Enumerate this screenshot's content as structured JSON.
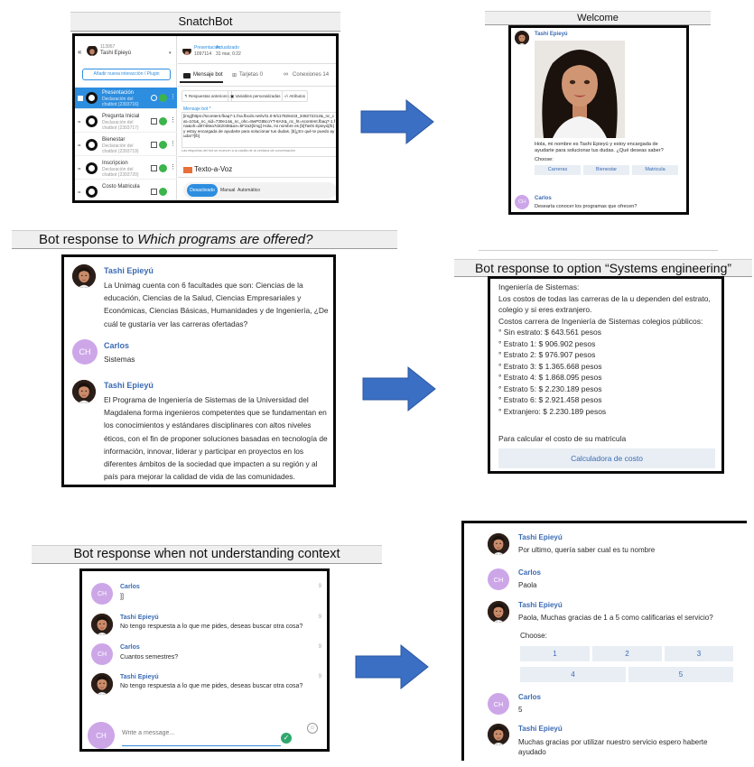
{
  "panels": {
    "snatchbot": {
      "title": "SnatchBot",
      "sidebar": {
        "header_small": "113957",
        "user_name": "Tashi Epieyú",
        "add_button": "Añadir nueva interacción / Plugin",
        "items": [
          {
            "label": "Presentación",
            "sub": "Declaración del chatbot (2393716)"
          },
          {
            "label": "Pregunta Inicial",
            "sub": "Declaración del chatbot (2393717)"
          },
          {
            "label": "Bienestar",
            "sub": "Declaración del chatbot (2393719)"
          },
          {
            "label": "Inscripcion",
            "sub": "Declaración del chatbot (2393720)"
          },
          {
            "label": "Costo Matricula",
            "sub": ""
          }
        ]
      },
      "main": {
        "header_name": "Presentación",
        "header_id": "1097114",
        "header_updated_label": "Actualizado",
        "header_updated_date": "31 mar, 0:22",
        "tabs": [
          "Mensaje bot",
          "Tarjetas 0",
          "Conexiones 14"
        ],
        "subtabs": [
          "Respuestas anteriores",
          "Variables personalizadas",
          "Atributos"
        ],
        "message_label": "Mensaje bot *",
        "message_text": "[img]https://scontent.fbaq7-1.fna.fbcdn.net/v/t1.0-9/117826443_348272212&_nc_cat=101&_nc_sid=730e14&_nc_ohc=8wPGtBcoYT-8AX&_nc_ht=scontent.fbaq7-1.fna&oh=d8748ea7d42048&oe=5F2a3[/img] Hola, mi nombre es [b]Tashi Epieyú[/b] y estoy encargada de ayudarte para solucionar tus dudas. [b]¿En qué te puedo ayudar?[/b]",
        "hint": "Las etiquetas del bot se mueven a la casilla de la ventana de conversación",
        "tts_label": "Texto-a-Voz",
        "tts_tabs": [
          "Desactivado",
          "Manual",
          "Automático"
        ]
      }
    },
    "welcome": {
      "title": "Welcome",
      "bot_name": "Tashi Epieyú",
      "message": "Hola, mi nombre es Tashi Epieyú y estoy encargada de ayudarte para solucionar tus dudas. ¿Qué deseas saber?",
      "choose_label": "Choose:",
      "choices": [
        "Carreras",
        "Bienestar",
        "Matricula"
      ],
      "user_name": "Carlos",
      "user_initials": "CH",
      "user_message": "Desearía conocer los programas que ofrecen?"
    },
    "programs": {
      "title_prefix": "Bot response to ",
      "title_italic": "Which programs are offered?",
      "bot_name": "Tashi Epieyú",
      "msg1": "La Unimag cuenta con 6 facultades que son: Ciencias de la educación, Ciencias de la Salud, Ciencias Empresariales y Económicas, Ciencias Básicas, Humanidades y de Ingeniería, ¿De cuál te gustaría ver las carreras ofertadas?",
      "user_name": "Carlos",
      "user_initials": "CH",
      "user_message": "Sistemas",
      "msg2": "El Programa de Ingeniería de Sistemas de la Universidad del Magdalena forma ingenieros competentes que se fundamentan en los conocimientos y estándares disciplinares con altos niveles éticos, con el fin de proponer soluciones basadas en tecnología de información, innovar, liderar y participar en proyectos en los diferentes ámbitos de la sociedad que impacten a su región y al país para mejorar la calidad de vida de las comunidades."
    },
    "systems": {
      "title": "Bot response to option “Systems engineering”",
      "lines": [
        "Ingeniería de Sistemas:",
        "Los costos de todas las carreras de la u dependen del estrato,",
        "colegio y si eres extranjero.",
        "Costos carrera de Ingeniería de Sistemas colegios públicos:",
        "° Sin estrato: $ 643.561 pesos",
        "° Estrato 1: $ 906.902 pesos",
        "° Estrato 2: $ 976.907 pesos",
        "° Estrato 3: $ 1.365.668 pesos",
        "° Estrato 4: $ 1.868.095 pesos",
        "° Estrato 5: $ 2.230.189 pesos",
        "° Estrato 6: $ 2.921.458 pesos",
        "° Extranjero: $ 2.230.189 pesos"
      ],
      "footer_text": "Para calcular el costo de su matricula",
      "button_label": "Calculadora de costo"
    },
    "context": {
      "title": "Bot response when not understanding context",
      "user_name": "Carlos",
      "user_initials": "CH",
      "bot_name": "Tashi Epieyú",
      "messages": [
        "]]",
        "No tengo respuesta a lo que me pides, deseas buscar otra cosa?",
        "Cuantos semestres?",
        "No tengo respuesta a lo que me pides, deseas buscar otra cosa?"
      ],
      "input_placeholder": "Write a message...",
      "time_mark": "9"
    },
    "rating": {
      "bot_name": "Tashi Epieyú",
      "user_name": "Carlos",
      "user_name2": "Carlos",
      "user_initials": "CH",
      "msg1": "Por ultimo, quería saber cual es tu nombre",
      "user_msg1": "Paola",
      "msg2": "Paola, Muchas gracias de 1 a 5 como calificarias el servicio?",
      "choose_label": "Choose:",
      "choices": [
        "1",
        "2",
        "3",
        "4",
        "5"
      ],
      "user_msg2": "5",
      "msg3": "Muchas gracias por utilizar nuestro servicio espero haberte ayudado"
    }
  },
  "colors": {
    "accent_blue": "#2d8ee0",
    "arrow": "#3a6fc4",
    "name_blue": "#3b6bb3",
    "avatar_purple": "#cda6e8"
  }
}
